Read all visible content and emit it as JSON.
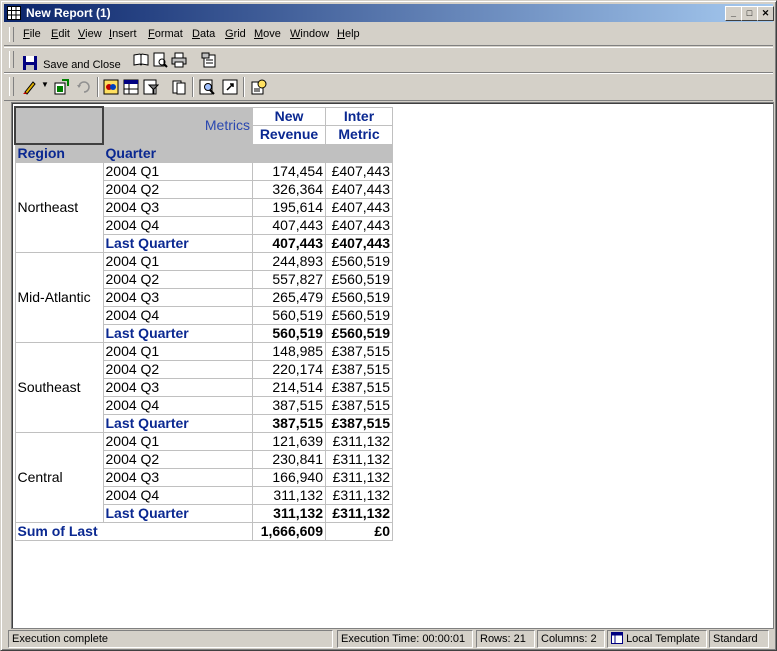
{
  "window": {
    "title": "New Report (1)"
  },
  "menu": [
    "File",
    "Edit",
    "View",
    "Insert",
    "Format",
    "Data",
    "Grid",
    "Move",
    "Window",
    "Help"
  ],
  "toolbar": {
    "save_close_label": "Save and Close"
  },
  "grid": {
    "metrics_label": "Metrics",
    "col_region": "Region",
    "col_quarter": "Quarter",
    "col_new_revenue_l1": "New",
    "col_new_revenue_l2": "Revenue",
    "col_inter_l1": "Inter",
    "col_inter_l2": "Metric",
    "groups": [
      {
        "region": "Northeast",
        "rows": [
          {
            "q": "2004 Q1",
            "rev": "174,454",
            "inter": "£407,443"
          },
          {
            "q": "2004 Q2",
            "rev": "326,364",
            "inter": "£407,443"
          },
          {
            "q": "2004 Q3",
            "rev": "195,614",
            "inter": "£407,443"
          },
          {
            "q": "2004 Q4",
            "rev": "407,443",
            "inter": "£407,443"
          },
          {
            "q": "Last Quarter",
            "rev": "407,443",
            "inter": "£407,443",
            "total": true
          }
        ]
      },
      {
        "region": "Mid-Atlantic",
        "rows": [
          {
            "q": "2004 Q1",
            "rev": "244,893",
            "inter": "£560,519"
          },
          {
            "q": "2004 Q2",
            "rev": "557,827",
            "inter": "£560,519"
          },
          {
            "q": "2004 Q3",
            "rev": "265,479",
            "inter": "£560,519"
          },
          {
            "q": "2004 Q4",
            "rev": "560,519",
            "inter": "£560,519"
          },
          {
            "q": "Last Quarter",
            "rev": "560,519",
            "inter": "£560,519",
            "total": true
          }
        ]
      },
      {
        "region": "Southeast",
        "rows": [
          {
            "q": "2004 Q1",
            "rev": "148,985",
            "inter": "£387,515"
          },
          {
            "q": "2004 Q2",
            "rev": "220,174",
            "inter": "£387,515"
          },
          {
            "q": "2004 Q3",
            "rev": "214,514",
            "inter": "£387,515"
          },
          {
            "q": "2004 Q4",
            "rev": "387,515",
            "inter": "£387,515"
          },
          {
            "q": "Last Quarter",
            "rev": "387,515",
            "inter": "£387,515",
            "total": true
          }
        ]
      },
      {
        "region": "Central",
        "rows": [
          {
            "q": "2004 Q1",
            "rev": "121,639",
            "inter": "£311,132"
          },
          {
            "q": "2004 Q2",
            "rev": "230,841",
            "inter": "£311,132"
          },
          {
            "q": "2004 Q3",
            "rev": "166,940",
            "inter": "£311,132"
          },
          {
            "q": "2004 Q4",
            "rev": "311,132",
            "inter": "£311,132"
          },
          {
            "q": "Last Quarter",
            "rev": "311,132",
            "inter": "£311,132",
            "total": true
          }
        ]
      }
    ],
    "sum_label": "Sum of Last",
    "sum_rev": "1,666,609",
    "sum_inter": "£0"
  },
  "status": {
    "message": "Execution complete",
    "exec_time": "Execution Time: 00:00:01",
    "rows": "Rows: 21",
    "columns": "Columns: 2",
    "template": "Local Template",
    "mode": "Standard"
  },
  "icons": [
    "grid-app-icon",
    "minimize-icon",
    "maximize-icon",
    "close-icon",
    "save-icon",
    "book-icon",
    "print-preview-icon",
    "print-icon",
    "export-icon",
    "pencil-icon",
    "wizard-icon",
    "refresh-icon",
    "toggle-icon",
    "table-icon",
    "filter-icon",
    "page-icon",
    "find-icon",
    "link-icon",
    "report-options-icon"
  ]
}
